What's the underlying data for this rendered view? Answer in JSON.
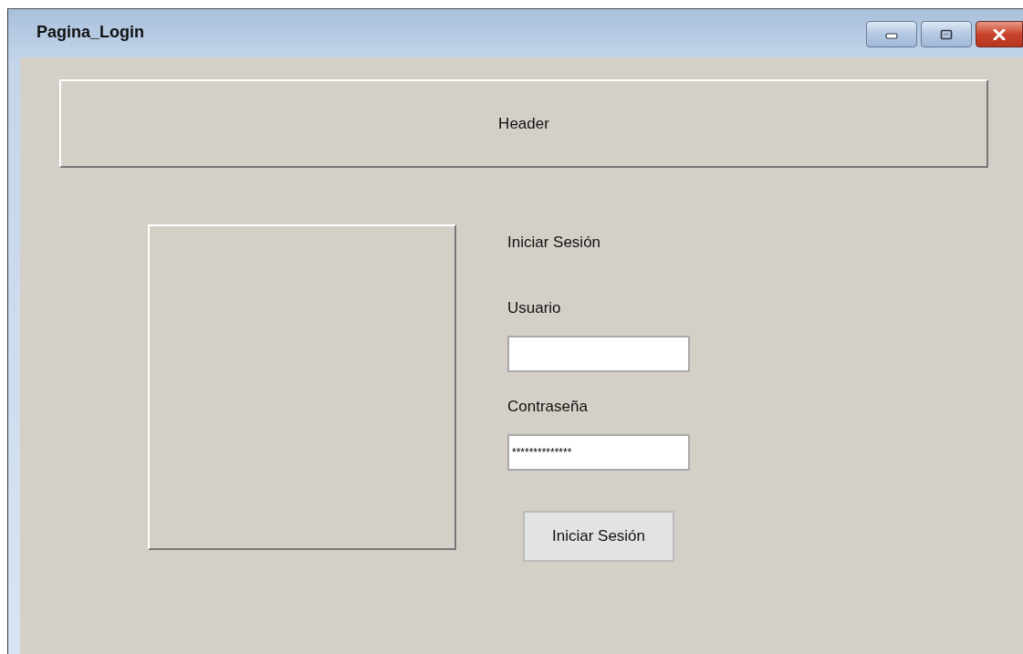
{
  "window": {
    "title": "Pagina_Login"
  },
  "header": {
    "label": "Header"
  },
  "login": {
    "title": "Iniciar Sesión",
    "username_label": "Usuario",
    "password_label": "Contraseña",
    "password_value": "**************",
    "button": "Iniciar Sesión"
  }
}
